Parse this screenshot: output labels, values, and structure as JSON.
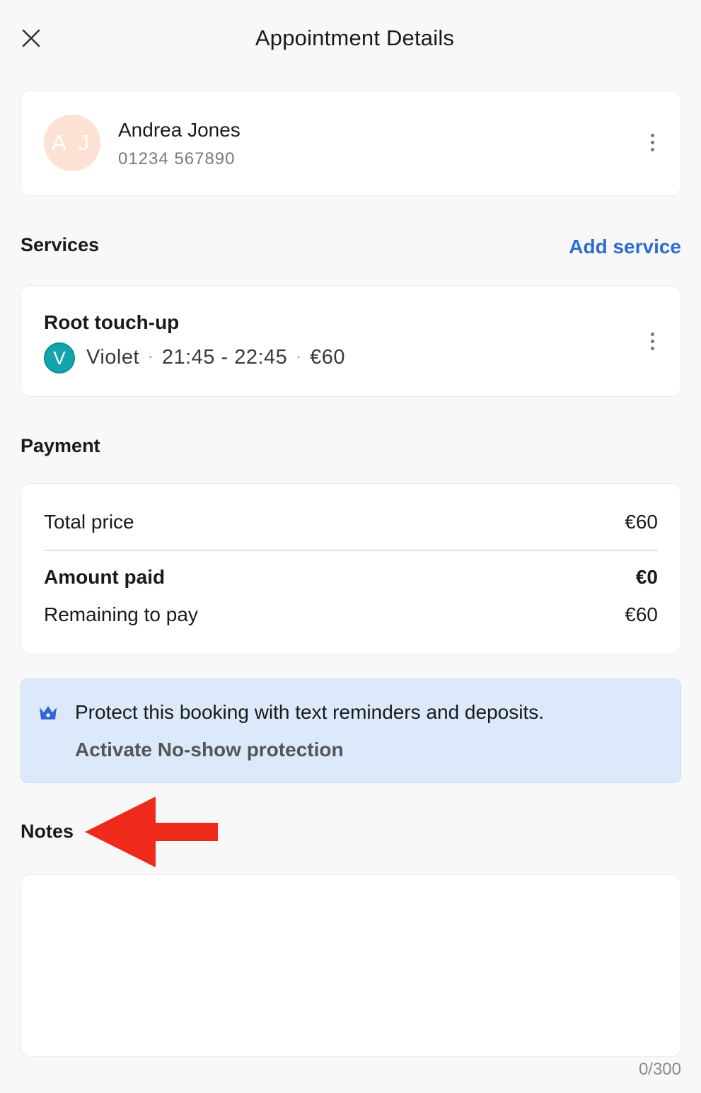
{
  "header": {
    "title": "Appointment Details",
    "close_icon": "close-icon"
  },
  "client": {
    "initials": "A J",
    "name": "Andrea Jones",
    "phone": "01234 567890",
    "avatar_color": "#fde1d3"
  },
  "services": {
    "title": "Services",
    "add_label": "Add service",
    "items": [
      {
        "name": "Root touch-up",
        "staff_initial": "V",
        "staff_name": "Violet",
        "time": "21:45 - 22:45",
        "price": "€60",
        "staff_color": "#13a4ad"
      }
    ]
  },
  "payment": {
    "title": "Payment",
    "total_label": "Total price",
    "total_value": "€60",
    "paid_label": "Amount paid",
    "paid_value": "€0",
    "remaining_label": "Remaining to pay",
    "remaining_value": "€60"
  },
  "promo": {
    "icon": "crown-icon",
    "text": "Protect this booking with text reminders and deposits.",
    "link": "Activate No-show protection",
    "background": "#dce9fb"
  },
  "notes": {
    "title": "Notes",
    "value": "",
    "count": "0/300"
  },
  "colors": {
    "accent_link": "#2e6bd1",
    "annotation_arrow": "#ee2a1b"
  }
}
